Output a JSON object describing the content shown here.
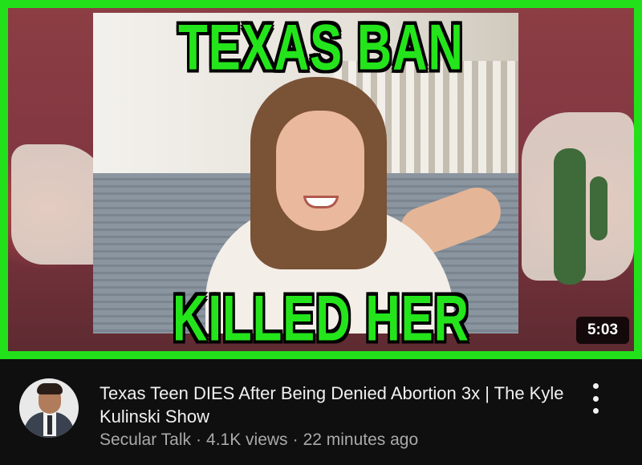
{
  "thumbnail": {
    "headline_top": "TEXAS BAN",
    "headline_bottom": "KILLED HER",
    "duration": "5:03",
    "frame_color": "#22e11b",
    "headline_color": "#24e51b"
  },
  "video": {
    "title": "Texas Teen DIES After Being Denied Abortion 3x | The Kyle Kulinski Show",
    "channel": "Secular Talk",
    "separator": "·",
    "views": "4.1K views",
    "age": "22 minutes ago"
  },
  "icons": {
    "menu": "more-vert-icon"
  }
}
